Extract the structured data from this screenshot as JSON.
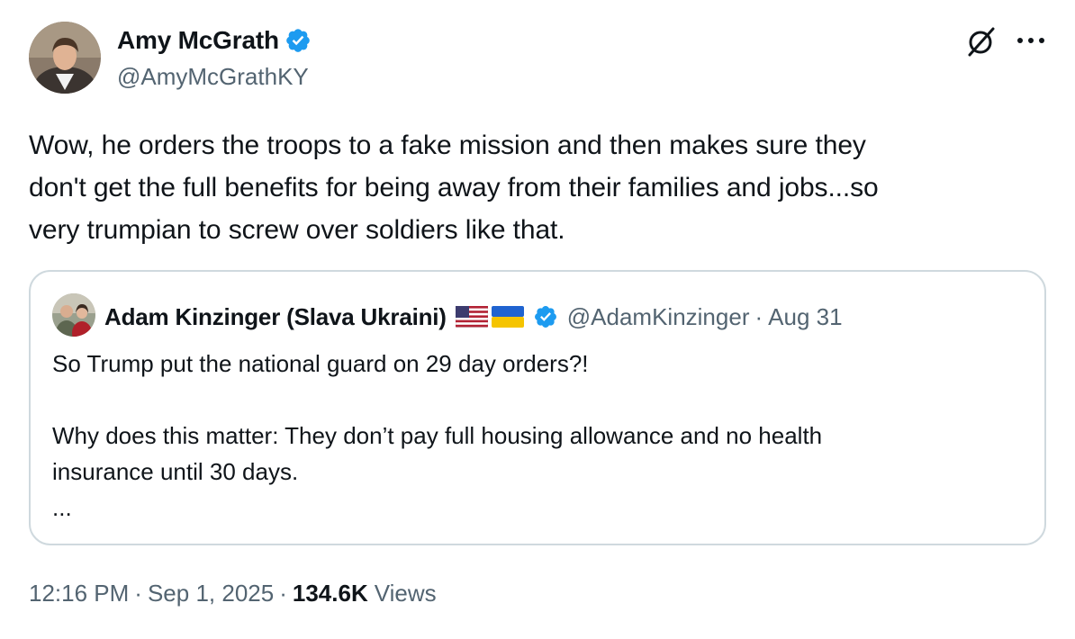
{
  "tweet": {
    "author": {
      "name": "Amy McGrath",
      "handle": "@AmyMcGrathKY",
      "verified": true
    },
    "text_lines": [
      "Wow, he orders the troops to a fake mission and then makes sure they",
      "don't get the full benefits for being away from their families and jobs...so",
      "very trumpian to screw over soldiers like that."
    ],
    "timestamp_time": "12:16 PM",
    "timestamp_date": "Sep 1, 2025",
    "separator": "·",
    "views_count": "134.6K",
    "views_label": "Views"
  },
  "quoted_tweet": {
    "author": {
      "name": "Adam Kinzinger (Slava Ukraini)",
      "handle": "@AdamKinzinger",
      "verified": true,
      "flags": [
        "us-flag",
        "ukraine-flag"
      ]
    },
    "date": "Aug 31",
    "separator": "·",
    "text_lines": [
      "So Trump put the national guard on 29 day orders?!",
      "",
      "Why does this matter:   They don’t pay full housing allowance and no health",
      "insurance until 30 days.",
      "..."
    ]
  },
  "icons": {
    "verified": "verified-badge-icon",
    "grok": "grok-icon",
    "more": "more-options-icon"
  },
  "colors": {
    "verified_blue": "#1d9bf0",
    "text_primary": "#0f1419",
    "text_secondary": "#536471",
    "border": "#cfd9de"
  }
}
